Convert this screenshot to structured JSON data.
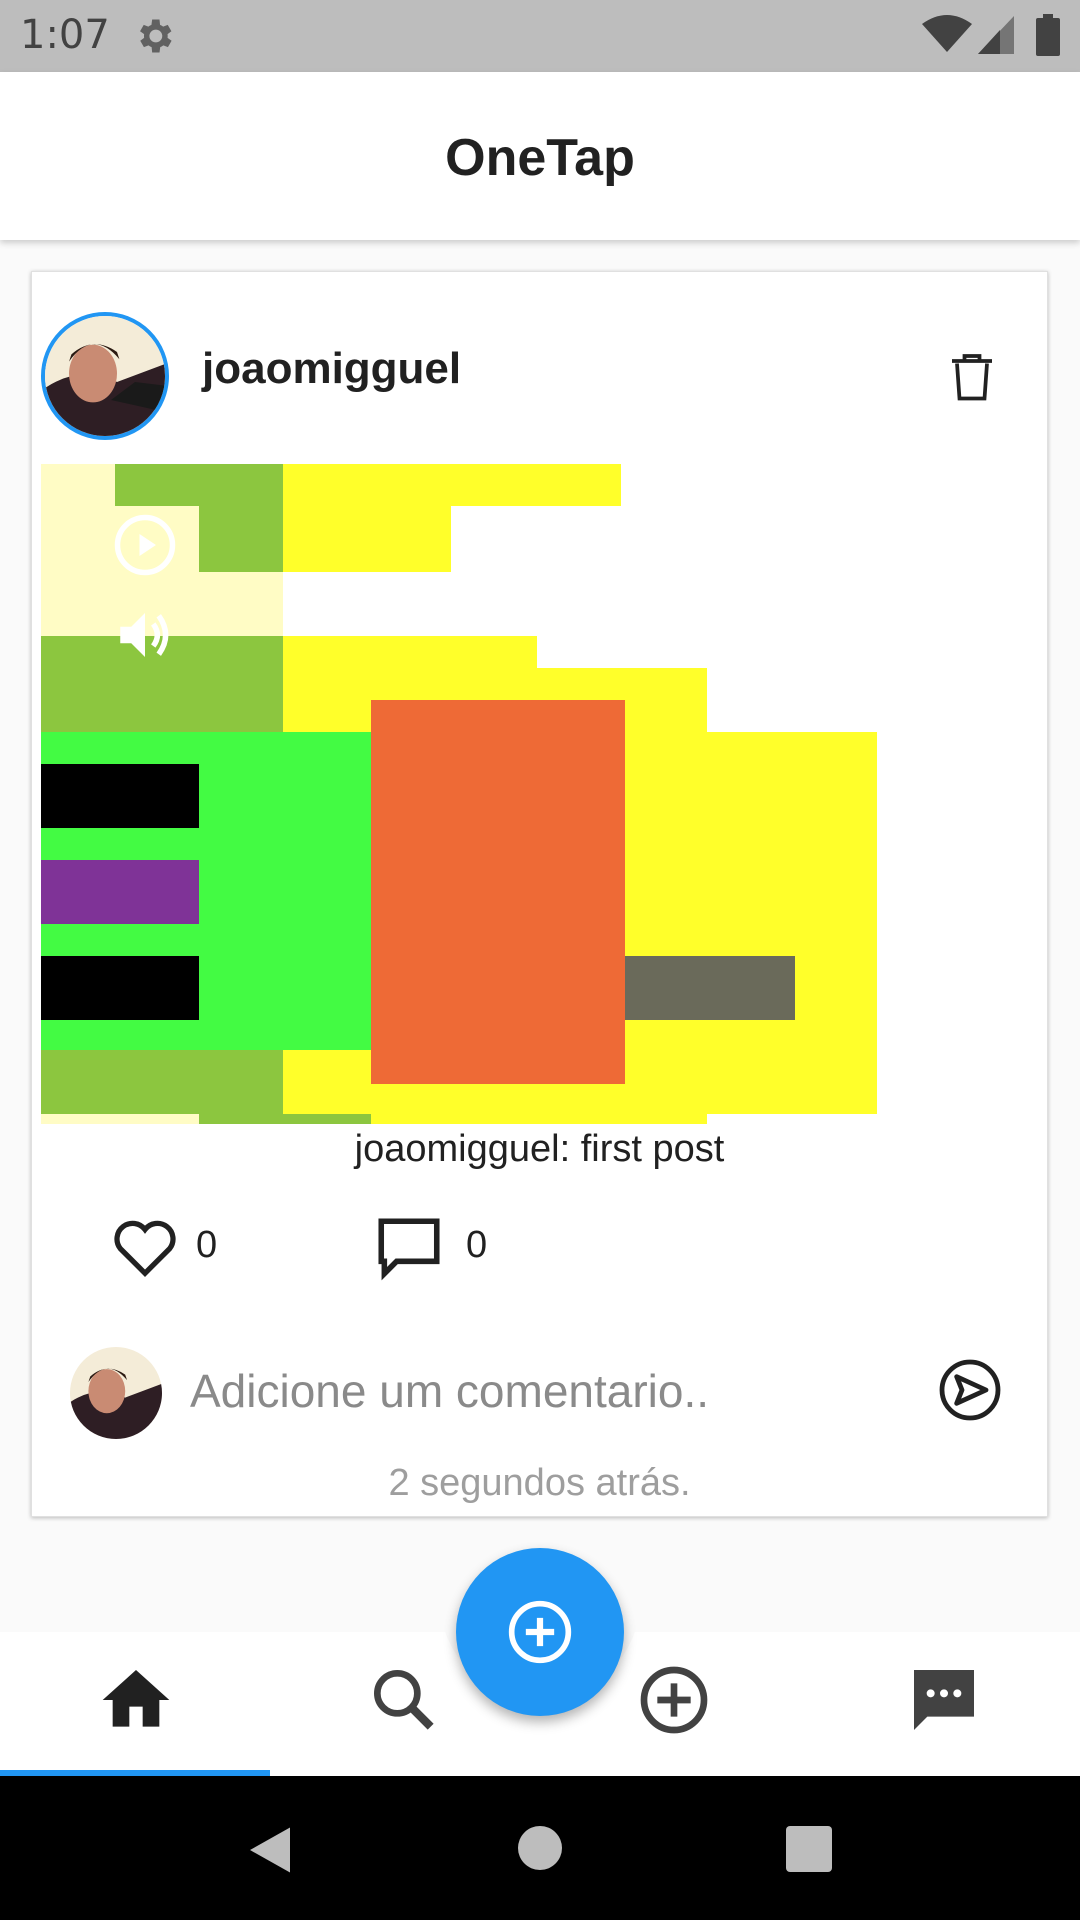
{
  "status_bar": {
    "time": "1:07",
    "icons": [
      "gear-icon",
      "wifi-icon",
      "signal-icon",
      "battery-icon"
    ]
  },
  "app_bar": {
    "title": "OneTap"
  },
  "post": {
    "username": "joaomigguel",
    "caption": "joaomigguel: first post",
    "likes": "0",
    "comments": "0",
    "comment_placeholder": "Adicione um comentario..",
    "timestamp": "2 segundos atrás.",
    "icons": [
      "trash-icon",
      "play-icon",
      "volume-icon",
      "heart-icon",
      "comment-icon",
      "send-icon"
    ]
  },
  "bottom_nav": {
    "items": [
      "home-icon",
      "search-icon",
      "add-circle-icon",
      "chat-icon"
    ],
    "active": "home-icon",
    "fab_icon": "add-circle-icon"
  },
  "colors": {
    "accent": "#2196f3",
    "status_bar": "#bdbdbd",
    "system_nav": "#000000"
  }
}
